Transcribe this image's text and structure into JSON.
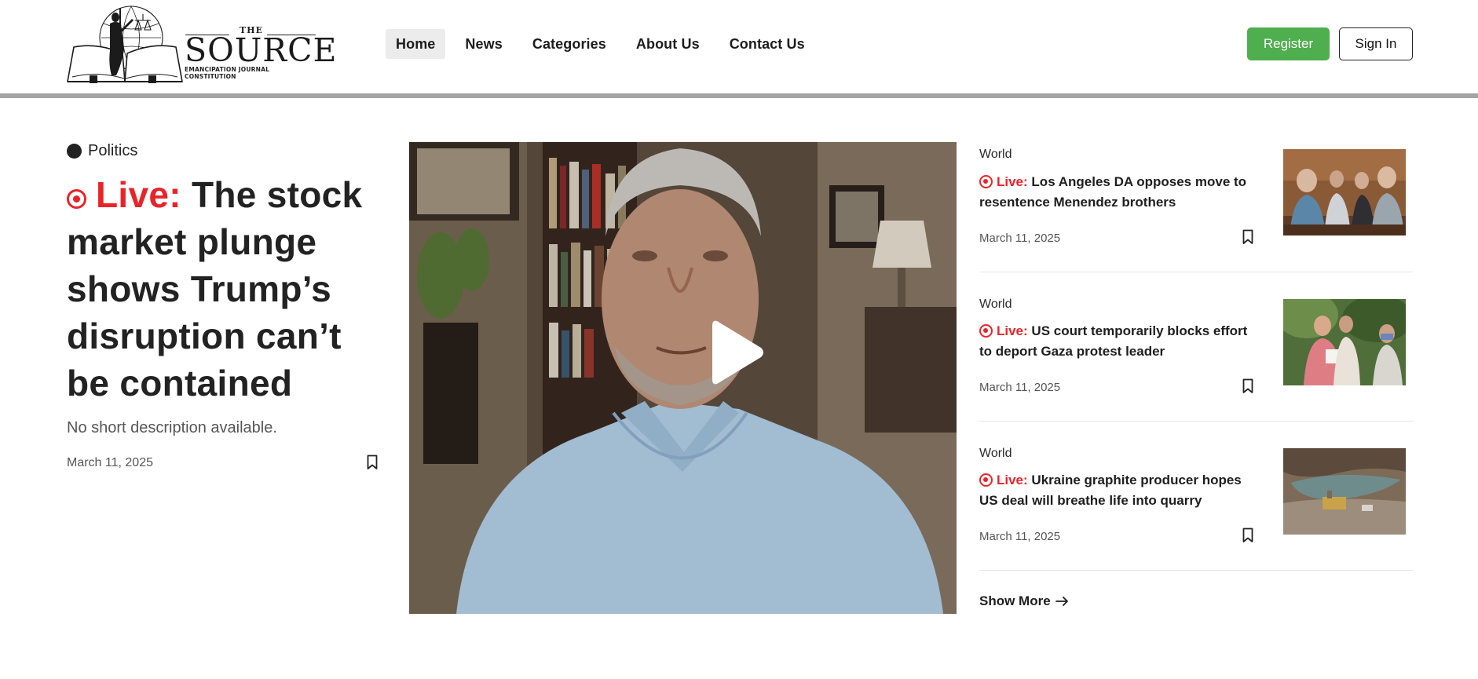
{
  "logo": {
    "small_text": "THE",
    "main_text": "SOURCE",
    "sub_text": "EMANCIPATION JOURNAL CONSTITUTION"
  },
  "nav": {
    "items": [
      {
        "label": "Home",
        "active": true
      },
      {
        "label": "News"
      },
      {
        "label": "Categories"
      },
      {
        "label": "About Us"
      },
      {
        "label": "Contact Us"
      }
    ]
  },
  "auth": {
    "register_label": "Register",
    "signin_label": "Sign In"
  },
  "feature": {
    "category": "Politics",
    "live_label": "Live:",
    "title": "The stock market plunge shows Trump’s disruption can’t be contained",
    "description": "No short description available.",
    "date": "March 11, 2025"
  },
  "stories": [
    {
      "category": "World",
      "live_label": "Live:",
      "title": "Los Angeles DA opposes move to resentence Menendez brothers",
      "date": "March 11, 2025"
    },
    {
      "category": "World",
      "live_label": "Live:",
      "title": "US court temporarily blocks effort to deport Gaza protest leader",
      "date": "March 11, 2025"
    },
    {
      "category": "World",
      "live_label": "Live:",
      "title": "Ukraine graphite producer hopes US deal will breathe life into quarry",
      "date": "March 11, 2025"
    }
  ],
  "show_more": {
    "label": "Show More",
    "icon": "arrow-right-icon"
  },
  "colors": {
    "accent_green": "#4fae4e",
    "live_red": "#e8242a",
    "header_rule": "#a4a4a4",
    "nav_active_bg": "#ececec"
  }
}
